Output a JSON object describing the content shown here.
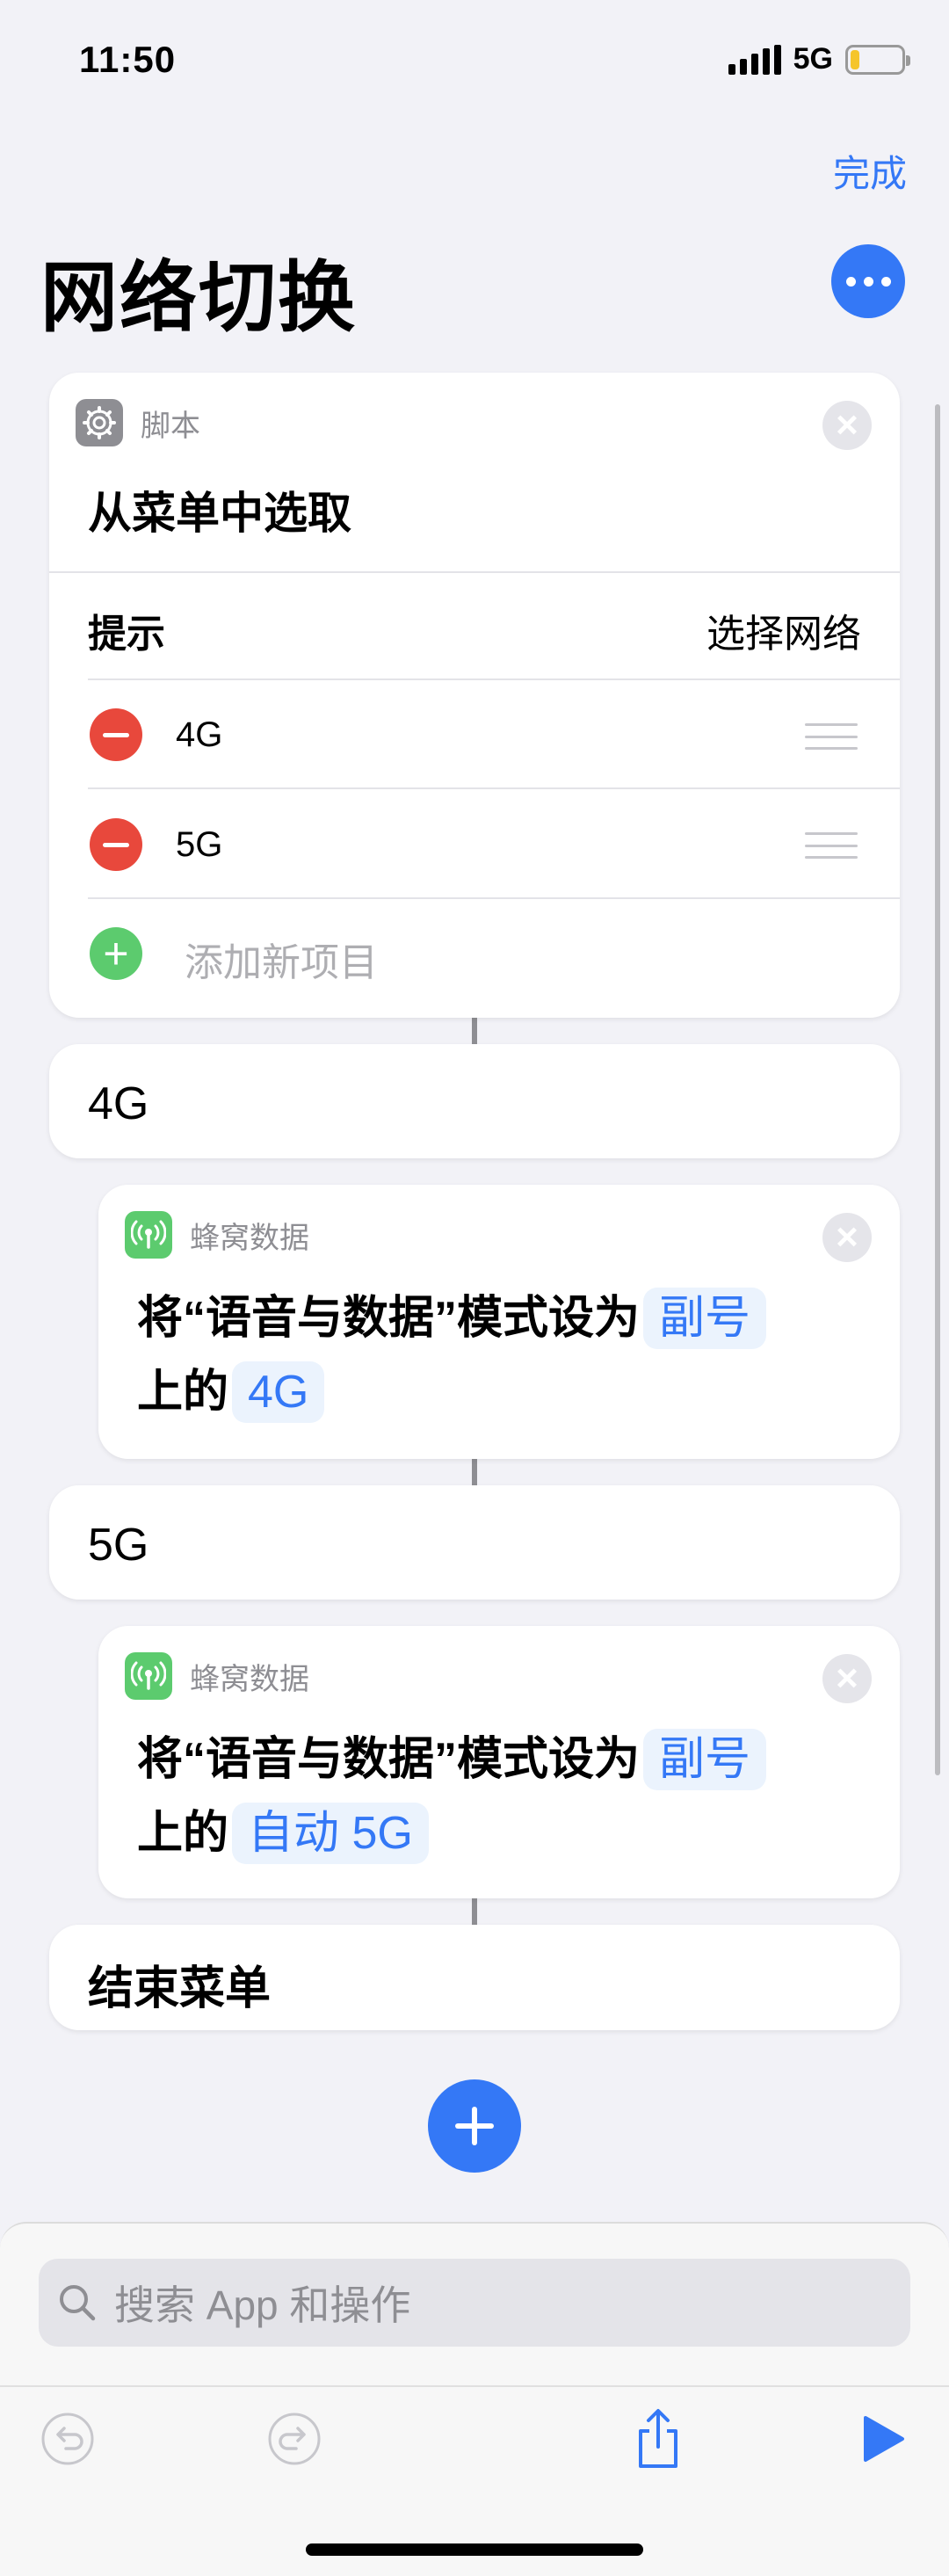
{
  "status_bar": {
    "time": "11:50",
    "network": "5G",
    "battery_level": 0.18
  },
  "header": {
    "done_label": "完成",
    "title": "网络切换"
  },
  "menu_action": {
    "category": "脚本",
    "title": "从菜单中选取",
    "prompt_label": "提示",
    "prompt_value": "选择网络",
    "items": [
      "4G",
      "5G"
    ],
    "add_item_label": "添加新项目"
  },
  "case_4g": {
    "label": "4G",
    "action": {
      "category": "蜂窝数据",
      "text_before": "将“语音与数据”模式设为",
      "sim_token": "副号",
      "text_middle": "上的",
      "mode_token": "4G"
    }
  },
  "case_5g": {
    "label": "5G",
    "action": {
      "category": "蜂窝数据",
      "text_before": "将“语音与数据”模式设为",
      "sim_token": "副号",
      "text_middle": "上的",
      "mode_token": "自动 5G"
    }
  },
  "end_menu": {
    "label": "结束菜单"
  },
  "search": {
    "placeholder": "搜索 App 和操作"
  },
  "colors": {
    "accent": "#3478f6",
    "remove": "#e8483c",
    "add": "#5ccb6e",
    "background": "#f2f2f7"
  },
  "icons": [
    "gear-icon",
    "antenna-icon",
    "close-icon",
    "minus-icon",
    "plus-icon",
    "drag-handle-icon",
    "ellipsis-icon",
    "search-icon",
    "undo-icon",
    "redo-icon",
    "share-icon",
    "play-icon"
  ]
}
